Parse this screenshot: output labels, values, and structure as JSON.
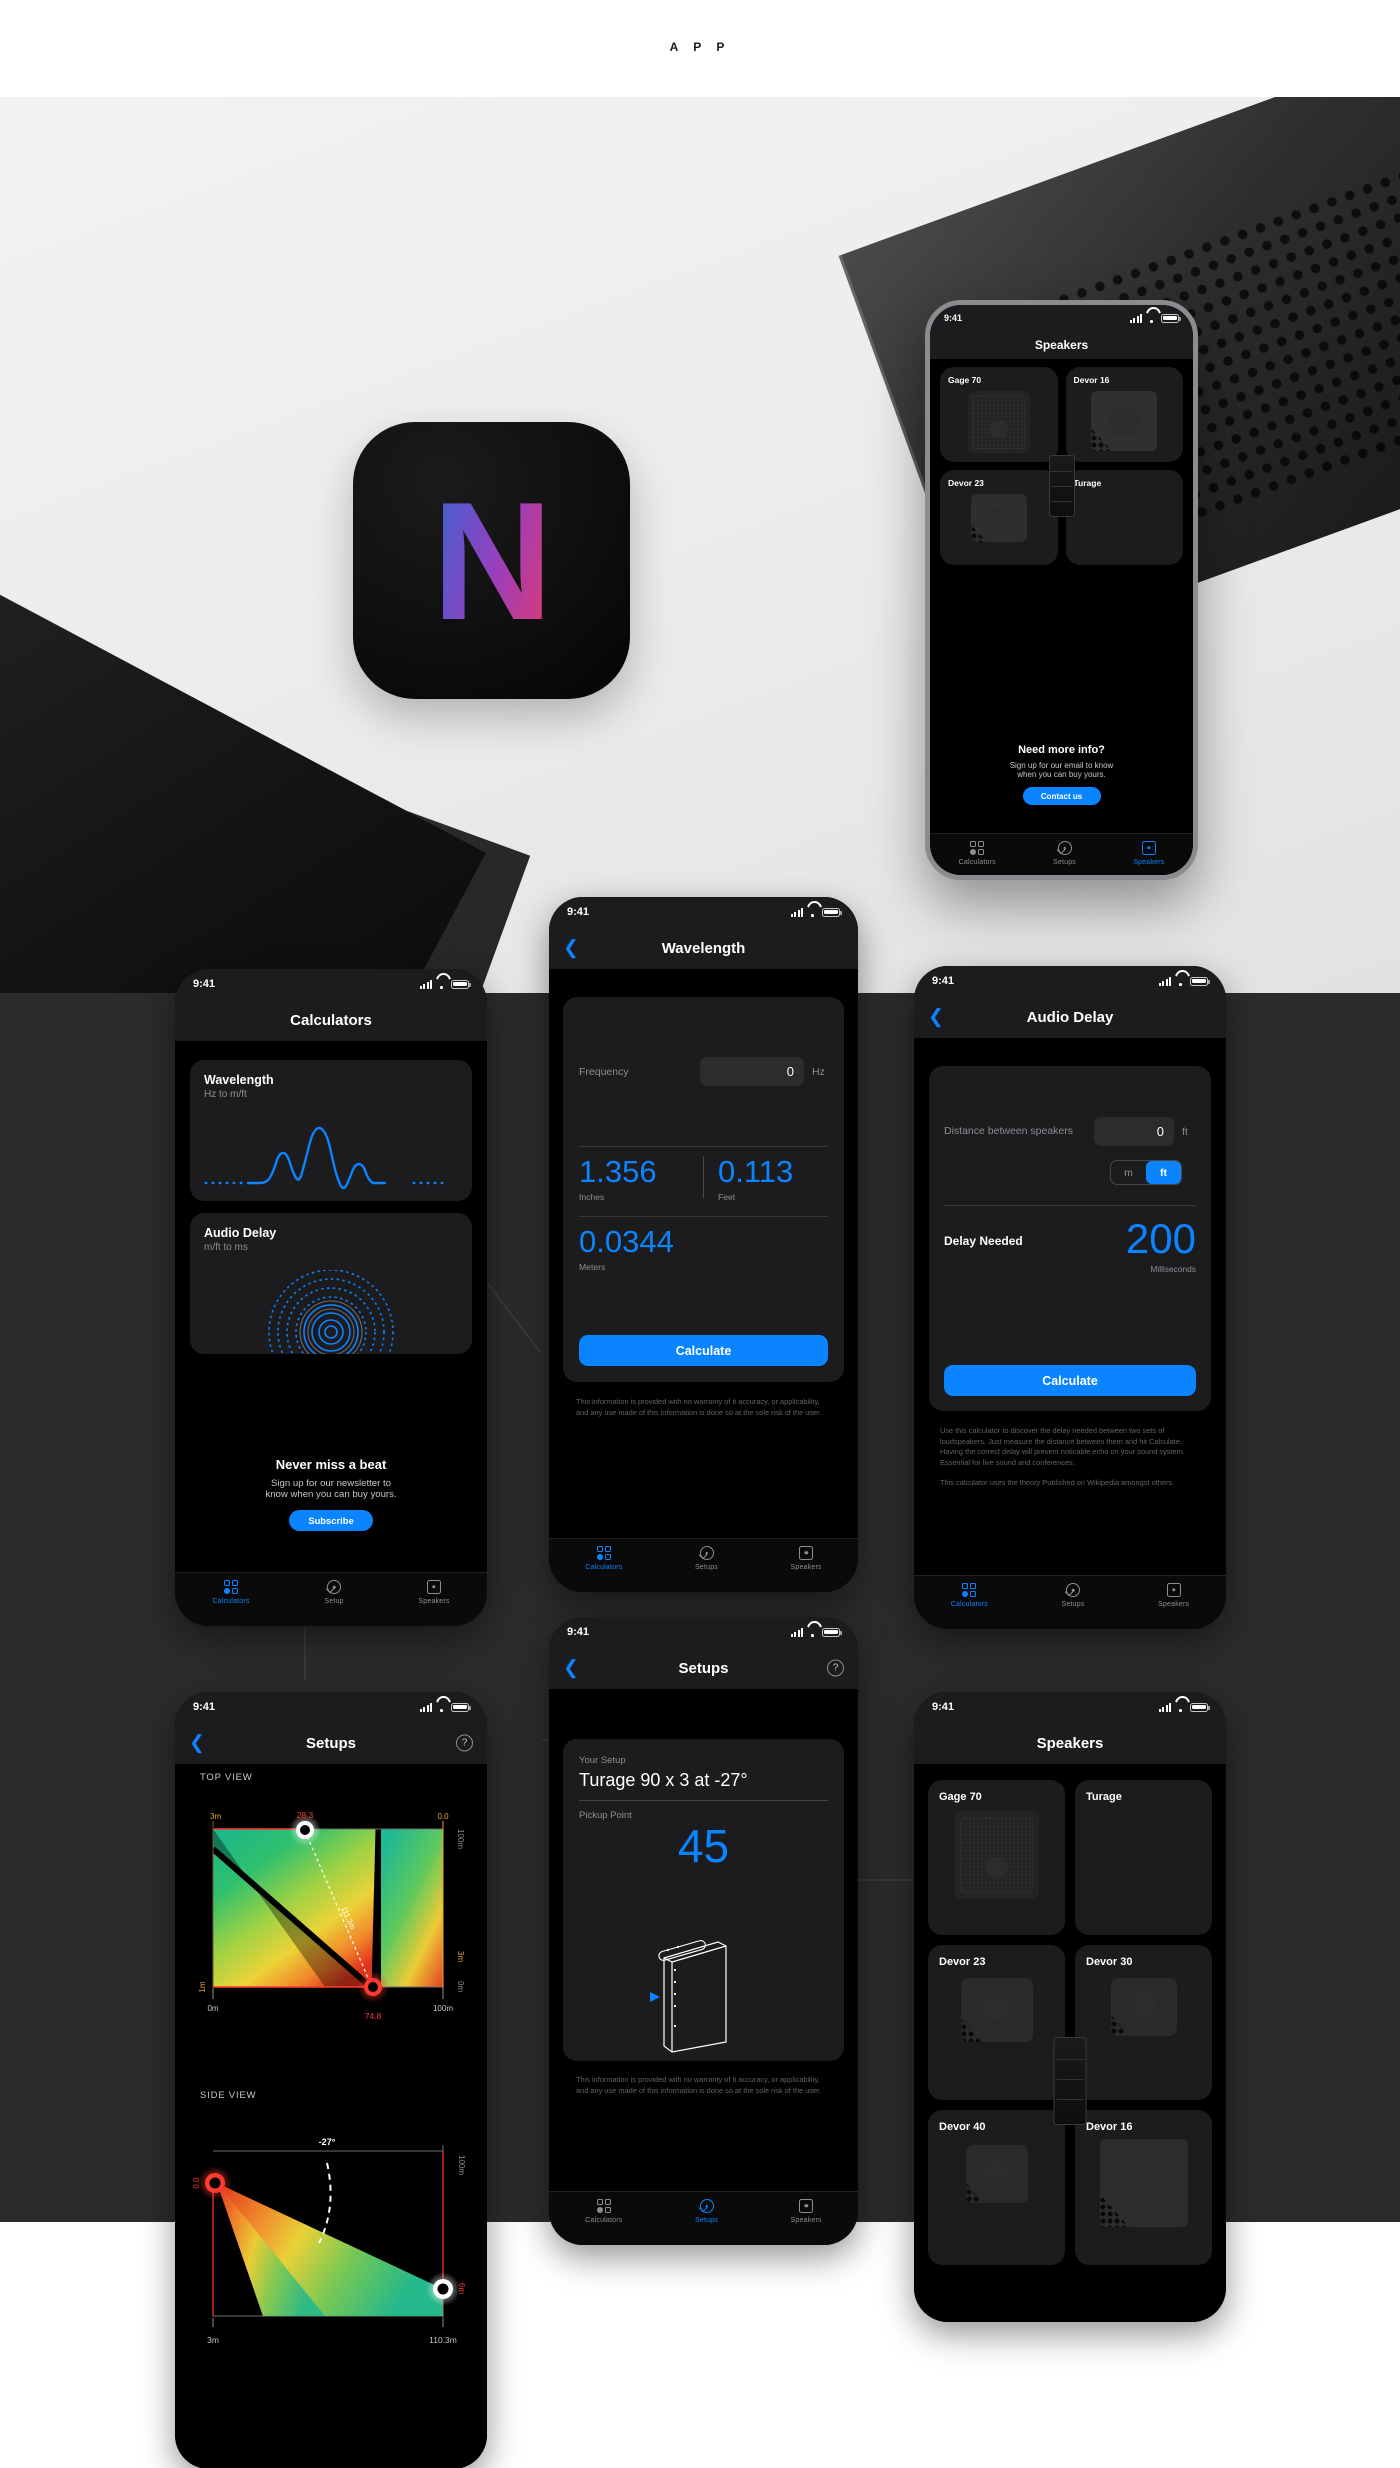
{
  "page": {
    "app_label": "A P P",
    "app_icon_letter": "N"
  },
  "colors": {
    "accent": "#0a84ff",
    "card": "#1c1c1e",
    "screen_bg": "#000000",
    "dark_section": "#2b2b2b",
    "muted_text": "#8e8e93"
  },
  "status_bar": {
    "time": "9:41",
    "signal_icon": "signal-bars-icon",
    "wifi_icon": "wifi-icon",
    "battery_icon": "battery-icon"
  },
  "tabs": {
    "calculators": "Calculators",
    "setup": "Setup",
    "setups": "Setups",
    "speakers": "Speakers"
  },
  "mockup_speakers": {
    "title": "Speakers",
    "items": [
      {
        "name": "Gage 70",
        "art": "grid-panel"
      },
      {
        "name": "Devor 16",
        "art": "hex-honeycomb"
      },
      {
        "name": "Devor 23",
        "art": "hex-plain"
      },
      {
        "name": "Turage",
        "art": "column"
      }
    ],
    "promo": {
      "title": "Need more info?",
      "body_line1": "Sign up for our email to know",
      "body_line2": "when you can buy yours.",
      "button": "Contact us"
    }
  },
  "calculators_screen": {
    "title": "Calculators",
    "cards": [
      {
        "title": "Wavelength",
        "subtitle": "Hz to m/ft",
        "art": "waveform"
      },
      {
        "title": "Audio Delay",
        "subtitle": "m/ft to ms",
        "art": "ripple"
      }
    ],
    "promo": {
      "title": "Never miss a beat",
      "body_line1": "Sign up for our newsletter to",
      "body_line2": "know when you can buy yours.",
      "button": "Subscribe"
    },
    "active_tab": "Calculators"
  },
  "wavelength_screen": {
    "title": "Wavelength",
    "back_icon": "chevron-left-icon",
    "input": {
      "label": "Frequency",
      "value": "0",
      "unit": "Hz",
      "placeholder": "0"
    },
    "results": [
      {
        "value": "1.356",
        "unit": "Inches"
      },
      {
        "value": "0.113",
        "unit": "Feet"
      },
      {
        "value": "0.0344",
        "unit": "Meters"
      }
    ],
    "button": "Calculate",
    "disclaimer": "This information is provided with no warranty of it accuracy, or applicability, and any use made of this information is done so at the sole risk of the user.",
    "active_tab": "Calculators"
  },
  "audio_delay_screen": {
    "title": "Audio Delay",
    "back_icon": "chevron-left-icon",
    "input": {
      "label": "Distance between speakers",
      "value": "0",
      "unit": "ft",
      "placeholder": "0"
    },
    "unit_toggle": {
      "options": [
        "m",
        "ft"
      ],
      "selected": "ft"
    },
    "result": {
      "label": "Delay Needed",
      "value": "200",
      "unit": "Milliseconds"
    },
    "button": "Calculate",
    "description_p1": "Use this calculator to discover the delay needed between two sets of loudspeakers. Just measure the distance between them and hit Calculate. Having the correct delay will prevent noticable echo on your sound system. Essential for live sound and conferences.",
    "description_p2": "This calculator uses the theory Published on Wikipedia amongst others.",
    "active_tab": "Calculators"
  },
  "setups_detail_screen": {
    "title": "Setups",
    "back_icon": "chevron-left-icon",
    "help_icon": "question-mark-icon",
    "setup_label": "Your Setup",
    "setup_value": "Turage 90 x 3 at -27°",
    "pickup_label": "Pickup Point",
    "pickup_value": "45",
    "disclaimer": "This information is provided with no warranty of it accuracy, or applicability, and any use made of this information is done so at the sole risk of the user.",
    "active_tab": "Setups"
  },
  "setups_chart_screen": {
    "title": "Setups",
    "back_icon": "chevron-left-icon",
    "help_icon": "question-mark-icon",
    "active_tab": "Setups"
  },
  "speakers_screen": {
    "title": "Speakers",
    "items": [
      {
        "name": "Gage 70",
        "art": "grid-panel"
      },
      {
        "name": "Turage",
        "art": "column"
      },
      {
        "name": "Devor 23",
        "art": "hex-honeycomb"
      },
      {
        "name": "Devor 30",
        "art": "hex-honeycomb"
      },
      {
        "name": "Devor 40",
        "art": "hex-honeycomb"
      },
      {
        "name": "Devor 16",
        "art": "hex-honeycomb-large"
      }
    ],
    "active_tab": "Speakers"
  },
  "chart_data": [
    {
      "type": "heatmap",
      "title": "TOP VIEW",
      "xlabel": "",
      "ylabel": "",
      "x_ticks": [
        "0m",
        "100m"
      ],
      "y_ticks": [
        "100m",
        "0m"
      ],
      "annotations": [
        {
          "text": "3m",
          "color": "#e8a33d",
          "position": "top-left"
        },
        {
          "text": "28.3",
          "color": "#ff3b30",
          "position": "top-center"
        },
        {
          "text": "0.0",
          "color": "#e8a33d",
          "position": "top-right"
        },
        {
          "text": "100m",
          "color": "#8e8e93",
          "position": "right-top"
        },
        {
          "text": "3m",
          "color": "#e8a33d",
          "position": "right-mid"
        },
        {
          "text": "0m",
          "color": "#8e8e93",
          "position": "right-bottom"
        },
        {
          "text": "1m",
          "color": "#e8a33d",
          "position": "left-bottom"
        },
        {
          "text": "74.8",
          "color": "#ff3b30",
          "position": "bottom-center"
        },
        {
          "text": "111.3m",
          "color": "#ffffff",
          "position": "diagonal-label"
        }
      ],
      "colorscale": [
        "#00b894",
        "#3ec77a",
        "#8fd34a",
        "#e8d23c",
        "#f08a2e",
        "#e03b20"
      ]
    },
    {
      "type": "heatmap",
      "title": "SIDE VIEW",
      "xlabel": "",
      "ylabel": "",
      "x_ticks": [
        "3m",
        "110.3m"
      ],
      "y_ticks": [
        "100m",
        "6m"
      ],
      "annotations": [
        {
          "text": "-27°",
          "color": "#ffffff",
          "position": "top-center"
        },
        {
          "text": "0.0",
          "color": "#ff3b30",
          "position": "left-mid"
        },
        {
          "text": "100m",
          "color": "#8e8e93",
          "position": "right-top"
        },
        {
          "text": "6m",
          "color": "#ff3b30",
          "position": "right-mid"
        }
      ],
      "colorscale": [
        "#e03b20",
        "#f08a2e",
        "#e8d23c",
        "#7ecb54",
        "#25b88a"
      ]
    }
  ]
}
